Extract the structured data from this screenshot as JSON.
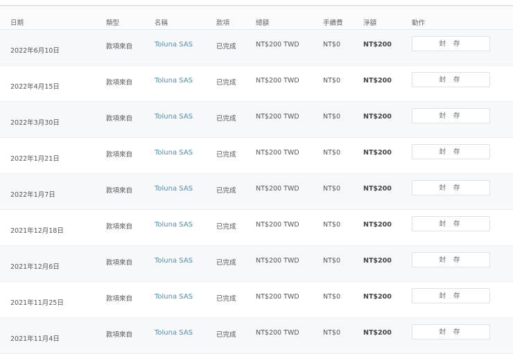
{
  "headers": {
    "date": "日期",
    "type": "類型",
    "name": "名稱",
    "status": "款項",
    "total": "總額",
    "fee": "手續費",
    "net": "淨額",
    "action": "動作"
  },
  "rows": [
    {
      "date": "2022年6月10日",
      "type": "款項來自",
      "name": "Toluna SAS",
      "status": "已完成",
      "total": "NT$200 TWD",
      "fee": "NT$0",
      "net": "NT$200",
      "action": "封 存"
    },
    {
      "date": "2022年4月15日",
      "type": "款項來自",
      "name": "Toluna SAS",
      "status": "已完成",
      "total": "NT$200 TWD",
      "fee": "NT$0",
      "net": "NT$200",
      "action": "封 存"
    },
    {
      "date": "2022年3月30日",
      "type": "款項來自",
      "name": "Toluna SAS",
      "status": "已完成",
      "total": "NT$200 TWD",
      "fee": "NT$0",
      "net": "NT$200",
      "action": "封 存"
    },
    {
      "date": "2022年1月21日",
      "type": "款項來自",
      "name": "Toluna SAS",
      "status": "已完成",
      "total": "NT$200 TWD",
      "fee": "NT$0",
      "net": "NT$200",
      "action": "封 存"
    },
    {
      "date": "2022年1月7日",
      "type": "款項來自",
      "name": "Toluna SAS",
      "status": "已完成",
      "total": "NT$200 TWD",
      "fee": "NT$0",
      "net": "NT$200",
      "action": "封 存"
    },
    {
      "date": "2021年12月18日",
      "type": "款項來自",
      "name": "Toluna SAS",
      "status": "已完成",
      "total": "NT$200 TWD",
      "fee": "NT$0",
      "net": "NT$200",
      "action": "封 存"
    },
    {
      "date": "2021年12月6日",
      "type": "款項來自",
      "name": "Toluna SAS",
      "status": "已完成",
      "total": "NT$200 TWD",
      "fee": "NT$0",
      "net": "NT$200",
      "action": "封 存"
    },
    {
      "date": "2021年11月25日",
      "type": "款項來自",
      "name": "Toluna SAS",
      "status": "已完成",
      "total": "NT$200 TWD",
      "fee": "NT$0",
      "net": "NT$200",
      "action": "封 存"
    },
    {
      "date": "2021年11月4日",
      "type": "款項來自",
      "name": "Toluna SAS",
      "status": "已完成",
      "total": "NT$200 TWD",
      "fee": "NT$0",
      "net": "NT$200",
      "action": "封 存"
    }
  ]
}
